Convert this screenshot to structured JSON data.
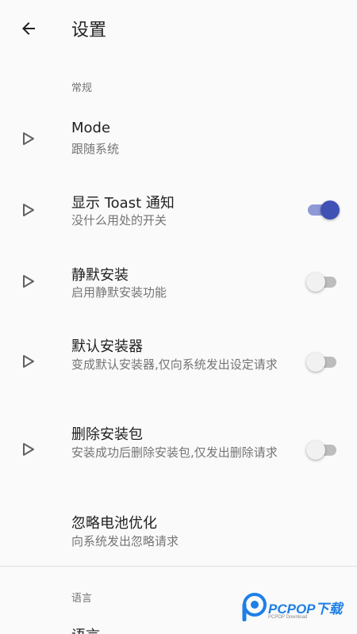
{
  "toolbar": {
    "title": "设置",
    "back_icon": "arrow-left-icon"
  },
  "sections": [
    {
      "header": "常规"
    },
    {
      "header": "语言"
    }
  ],
  "preferences": [
    {
      "title": "Mode",
      "summary": "跟随系统",
      "has_arrow": true,
      "switch": null
    },
    {
      "title": "显示 Toast 通知",
      "summary": "没什么用处的开关",
      "has_arrow": true,
      "switch": true
    },
    {
      "title": "静默安装",
      "summary": "启用静默安装功能",
      "has_arrow": true,
      "switch": false
    },
    {
      "title": "默认安装器",
      "summary": "变成默认安装器,仅向系统发出设定请求",
      "has_arrow": true,
      "switch": false
    },
    {
      "title": "删除安装包",
      "summary": "安装成功后删除安装包,仅发出删除请求",
      "has_arrow": true,
      "switch": false
    },
    {
      "title": "忽略电池优化",
      "summary": "向系统发出忽略请求",
      "has_arrow": false,
      "switch": null
    }
  ],
  "partial_item": {
    "title": "语言"
  },
  "watermark": {
    "brand": "PCPOP下载",
    "sub": "PCPOP Download"
  },
  "colors": {
    "accent": "#3f51b5",
    "accent_track": "#8e99d6",
    "switch_off_track": "#bdbdbd",
    "watermark": "#1f7fe6"
  }
}
